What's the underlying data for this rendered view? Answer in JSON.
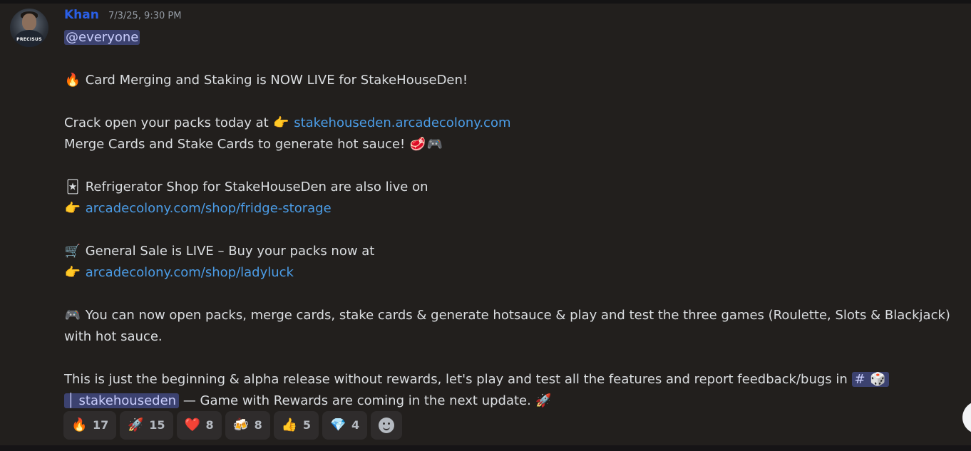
{
  "message": {
    "author": "Khan",
    "timestamp": "7/3/25, 9:30 PM",
    "avatar_tag": "PRECISUS",
    "mention": "@everyone",
    "l1_emoji": "🔥",
    "l1_text": "Card Merging and Staking is NOW LIVE for StakeHouseDen!",
    "l2_text": "Crack open your packs today at",
    "l2_emoji": "👉",
    "l2_link": "stakehouseden.arcadecolony.com",
    "l3_text": "Merge Cards and Stake Cards to generate hot sauce!",
    "l3_emoji1": "🥩",
    "l3_emoji2": "🎮",
    "l4_emoji": "🃏",
    "l4_text": "Refrigerator Shop for StakeHouseDen are also live on",
    "l5_emoji": "👉",
    "l5_link": "arcadecolony.com/shop/fridge-storage",
    "l6_emoji": "🛒",
    "l6_text": "General Sale is LIVE – Buy your packs now at",
    "l7_emoji": "👉",
    "l7_link": "arcadecolony.com/shop/ladyluck",
    "l8_emoji": "🎮",
    "l8_text": "You can now open packs, merge cards, stake cards & generate hotsauce & play and test the three games (Roulette, Slots & Blackjack) with hot sauce.",
    "l9_text": "This is just the beginning & alpha release without rewards, let's play and test all the features and report feedback/bugs in",
    "channel_hash": "#",
    "channel_emoji": "🎲",
    "channel_name": "│ stakehouseden",
    "l10_text": "— Game with Rewards are coming in the next update.",
    "l10_emoji": "🚀"
  },
  "reactions": [
    {
      "emoji": "🔥",
      "count": "17"
    },
    {
      "emoji": "🚀",
      "count": "15"
    },
    {
      "emoji": "❤️",
      "count": "8"
    },
    {
      "emoji": "🍻",
      "count": "8"
    },
    {
      "emoji": "👍",
      "count": "5"
    },
    {
      "emoji": "💎",
      "count": "4"
    }
  ],
  "icons": {
    "add_reaction": "smiley-icon",
    "scroll": "circle-button-icon"
  }
}
